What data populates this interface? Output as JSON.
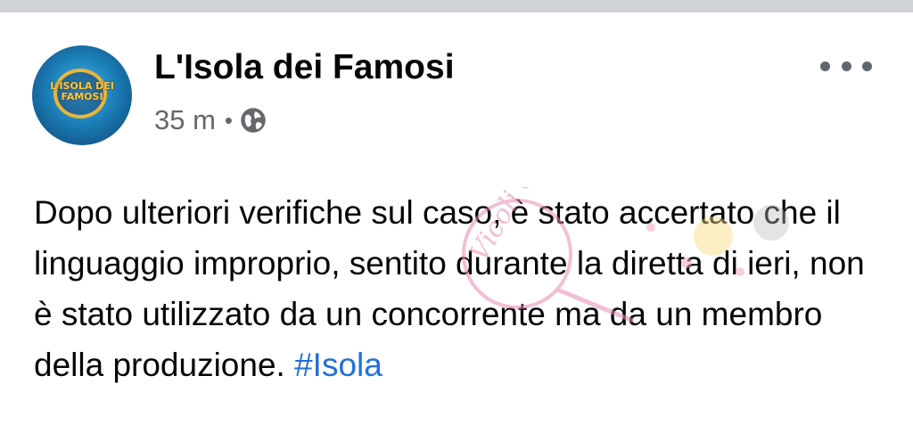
{
  "post": {
    "page_name": "L'Isola dei Famosi",
    "timestamp": "35 m",
    "separator": "•",
    "audience_icon": "globe-icon",
    "more_icon": "more-options-icon",
    "avatar_text": "L'ISOLA DEI FAMOSI",
    "body_text": "Dopo ulteriori verifiche sul caso, è stato accertato che il linguaggio improprio, sentito durante la diretta di ieri, non è stato utilizzato da un concorrente ma da un membro della produzione.",
    "hashtag": "#Isola"
  },
  "watermark": {
    "text": "Vicoli dalle Idee"
  },
  "colors": {
    "top_bar": "#cfd2d6",
    "text": "#050505",
    "secondary_text": "#65676b",
    "link": "#216fdb",
    "watermark_pink": "#e88bb3",
    "watermark_yellow": "#f2c94c"
  }
}
